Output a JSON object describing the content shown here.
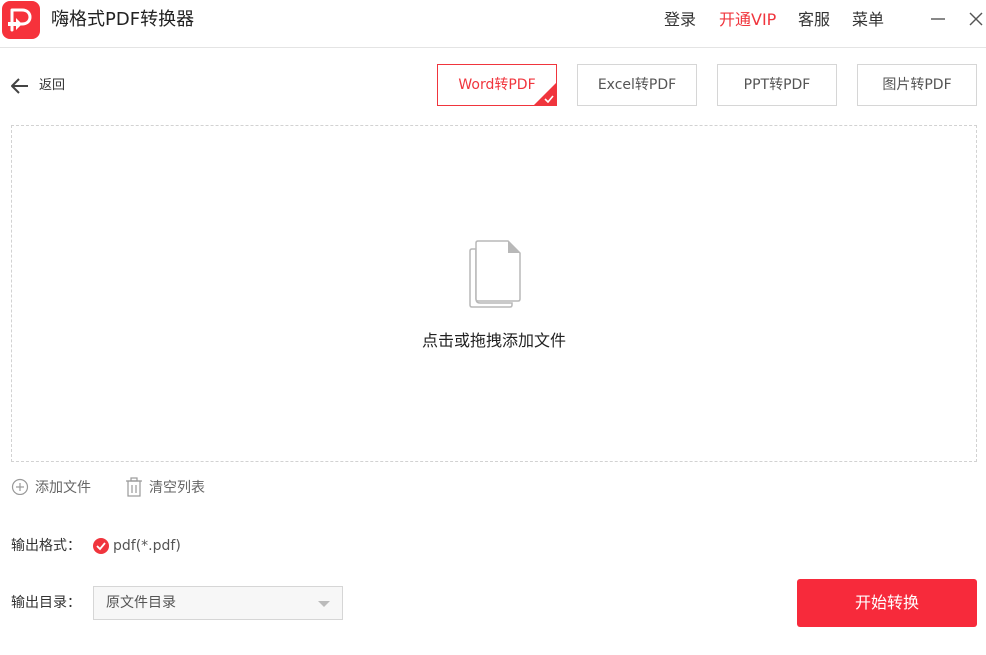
{
  "app": {
    "title": "嗨格式PDF转换器"
  },
  "topbar": {
    "login": "登录",
    "vip": "开通VIP",
    "service": "客服",
    "menu": "菜单"
  },
  "nav": {
    "back": "返回"
  },
  "tabs": [
    {
      "label": "Word转PDF",
      "active": true
    },
    {
      "label": "Excel转PDF",
      "active": false
    },
    {
      "label": "PPT转PDF",
      "active": false
    },
    {
      "label": "图片转PDF",
      "active": false
    }
  ],
  "dropzone": {
    "text": "点击或拖拽添加文件"
  },
  "actions": {
    "add_file": "添加文件",
    "clear_list": "清空列表"
  },
  "output": {
    "format_label": "输出格式：",
    "format_value": "pdf(*.pdf)",
    "dir_label": "输出目录：",
    "dir_value": "原文件目录"
  },
  "start_button": "开始转换",
  "colors": {
    "accent": "#f0353d",
    "button": "#f72a3b"
  },
  "icons": {
    "logo": "pdf-logo-icon",
    "minimize": "minimize-icon",
    "close": "close-icon",
    "back": "arrow-left-icon",
    "file": "document-icon",
    "add": "plus-circle-icon",
    "clear": "trash-icon",
    "check": "check-circle-icon",
    "dropdown": "chevron-down-icon"
  }
}
